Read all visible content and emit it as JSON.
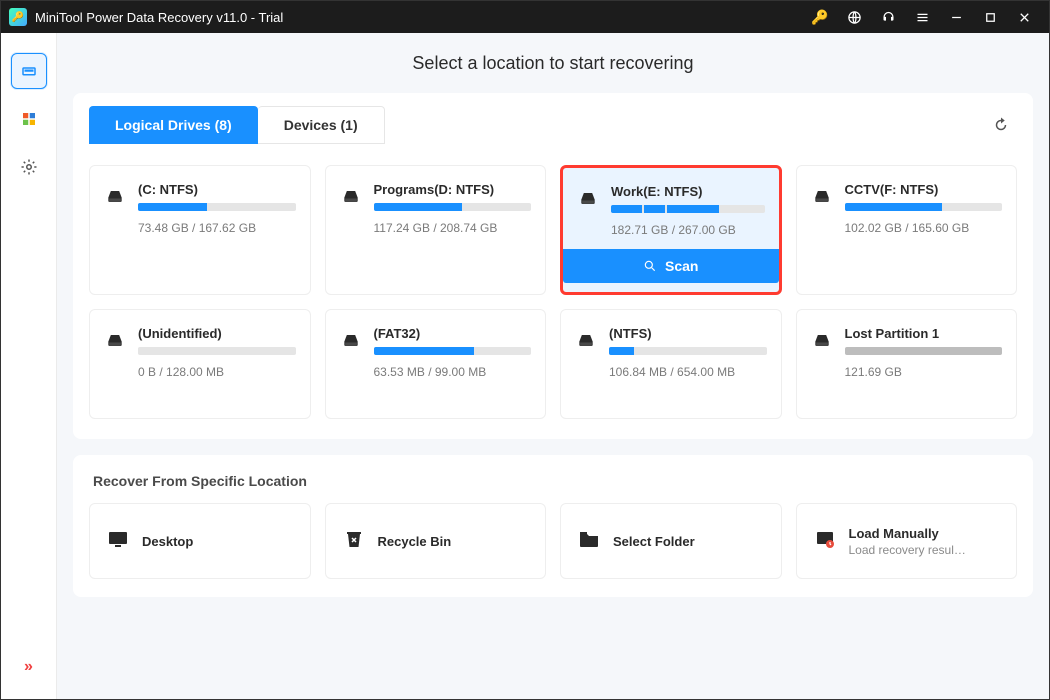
{
  "title": "MiniTool Power Data Recovery v11.0 - Trial",
  "header": {
    "title": "Select a location to start recovering"
  },
  "tabs": {
    "logical": "Logical Drives (8)",
    "devices": "Devices (1)"
  },
  "drives": [
    {
      "name": "(C: NTFS)",
      "size": "73.48 GB / 167.62 GB",
      "pct": 44,
      "lost": false
    },
    {
      "name": "Programs(D: NTFS)",
      "size": "117.24 GB / 208.74 GB",
      "pct": 56,
      "lost": false
    },
    {
      "name": "Work(E: NTFS)",
      "size": "182.71 GB / 267.00 GB",
      "pct": 68,
      "lost": false,
      "selected": true,
      "segments": [
        20,
        14,
        34
      ]
    },
    {
      "name": "CCTV(F: NTFS)",
      "size": "102.02 GB / 165.60 GB",
      "pct": 62,
      "lost": false
    },
    {
      "name": "(Unidentified)",
      "size": "0 B / 128.00 MB",
      "pct": 0,
      "lost": false
    },
    {
      "name": "(FAT32)",
      "size": "63.53 MB / 99.00 MB",
      "pct": 64,
      "lost": false
    },
    {
      "name": "(NTFS)",
      "size": "106.84 MB / 654.00 MB",
      "pct": 16,
      "lost": false
    },
    {
      "name": "Lost Partition 1",
      "size": "121.69 GB",
      "pct": 100,
      "lost": true
    }
  ],
  "scan_label": "Scan",
  "section2": {
    "title": "Recover From Specific Location"
  },
  "locations": [
    {
      "label": "Desktop"
    },
    {
      "label": "Recycle Bin"
    },
    {
      "label": "Select Folder"
    },
    {
      "label": "Load Manually",
      "sub": "Load recovery result (*..."
    }
  ]
}
